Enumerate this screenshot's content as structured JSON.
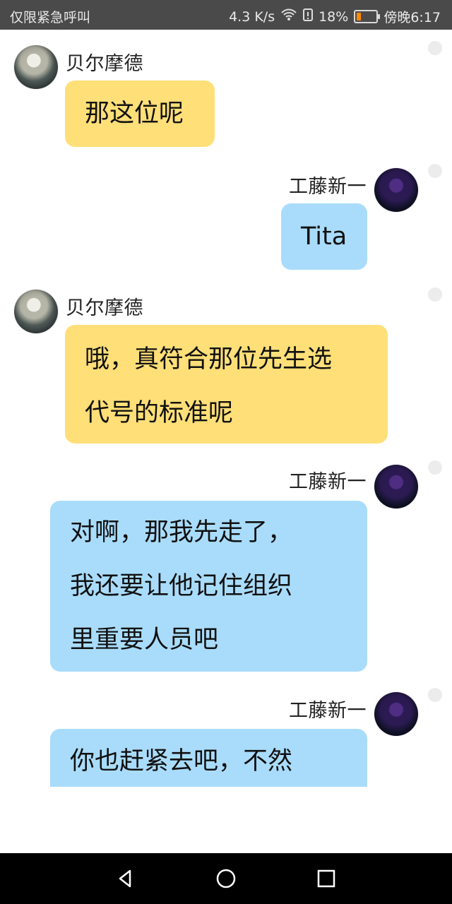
{
  "status_bar": {
    "left_text": "仅限紧急呼叫",
    "network_speed": "4.3 K/s",
    "battery_percent": "18%",
    "time": "傍晚6:17",
    "battery_level": 0.18,
    "icons": [
      "wifi-icon",
      "sim-icon",
      "battery-icon"
    ]
  },
  "chat": {
    "messages": [
      {
        "sender": "贝尔摩德",
        "side": "left",
        "avatar": "vermouth-avatar",
        "lines": [
          "那这位呢"
        ]
      },
      {
        "sender": "工藤新一",
        "side": "right",
        "avatar": "shinichi-avatar",
        "lines": [
          "Tita"
        ]
      },
      {
        "sender": "贝尔摩德",
        "side": "left",
        "avatar": "vermouth-avatar",
        "lines": [
          "哦，真符合那位先生选",
          "代号的标准呢"
        ]
      },
      {
        "sender": "工藤新一",
        "side": "right",
        "avatar": "shinichi-avatar",
        "lines": [
          "对啊，那我先走了，",
          "我还要让他记住组织",
          "里重要人员吧"
        ]
      },
      {
        "sender": "工藤新一",
        "side": "right",
        "avatar": "shinichi-avatar",
        "lines": [
          "你也赶紧去吧，不然"
        ]
      }
    ]
  },
  "colors": {
    "left_bubble": "#ffdf78",
    "right_bubble": "#a9dcfb",
    "status_bar_bg": "#4a4a4a",
    "nav_bar_bg": "#000000"
  },
  "nav_bar": {
    "icons": [
      "back-icon",
      "home-icon",
      "recents-icon"
    ]
  }
}
